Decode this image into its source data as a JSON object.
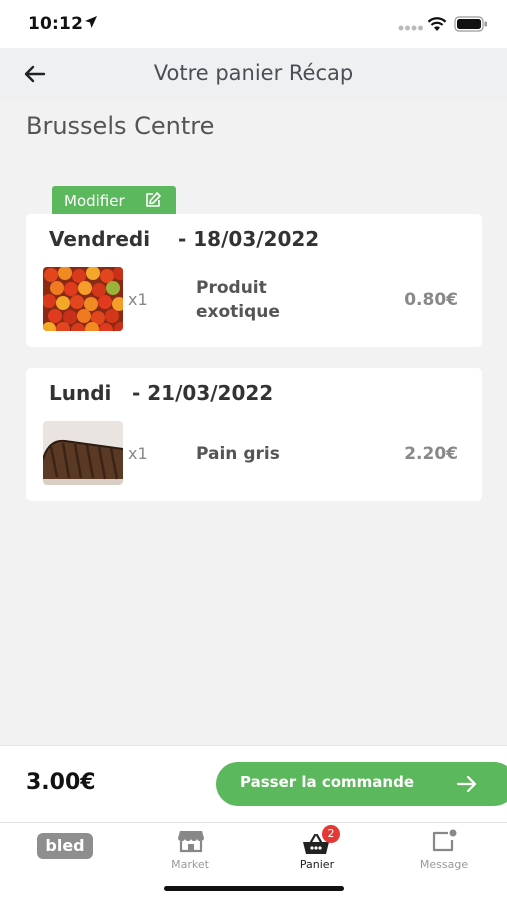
{
  "status_bar": {
    "time": "10:12"
  },
  "header": {
    "title": "Votre panier Récap"
  },
  "location": {
    "name": "Brussels Centre"
  },
  "modifier": {
    "label": "Modifier"
  },
  "orders": [
    {
      "day": "Vendredi",
      "date": "- 18/03/2022",
      "item": {
        "qty": "x1",
        "name": "Produit exotique",
        "price": "0.80€",
        "image": "tomatoes"
      }
    },
    {
      "day": "Lundi",
      "date": "- 21/03/2022",
      "item": {
        "qty": "x1",
        "name": "Pain gris",
        "price": "2.20€",
        "image": "bread"
      }
    }
  ],
  "footer": {
    "total": "3.00€",
    "order_button": "Passer la commande"
  },
  "tabs": [
    {
      "label": "bled",
      "icon": "bled-logo"
    },
    {
      "label": "Market",
      "icon": "store-icon"
    },
    {
      "label": "Panier",
      "icon": "basket-icon",
      "badge": "2",
      "active": true
    },
    {
      "label": "Message",
      "icon": "message-icon"
    }
  ],
  "colors": {
    "accent": "#5cb85c",
    "badge": "#e53935",
    "background": "#f2f2f2"
  }
}
